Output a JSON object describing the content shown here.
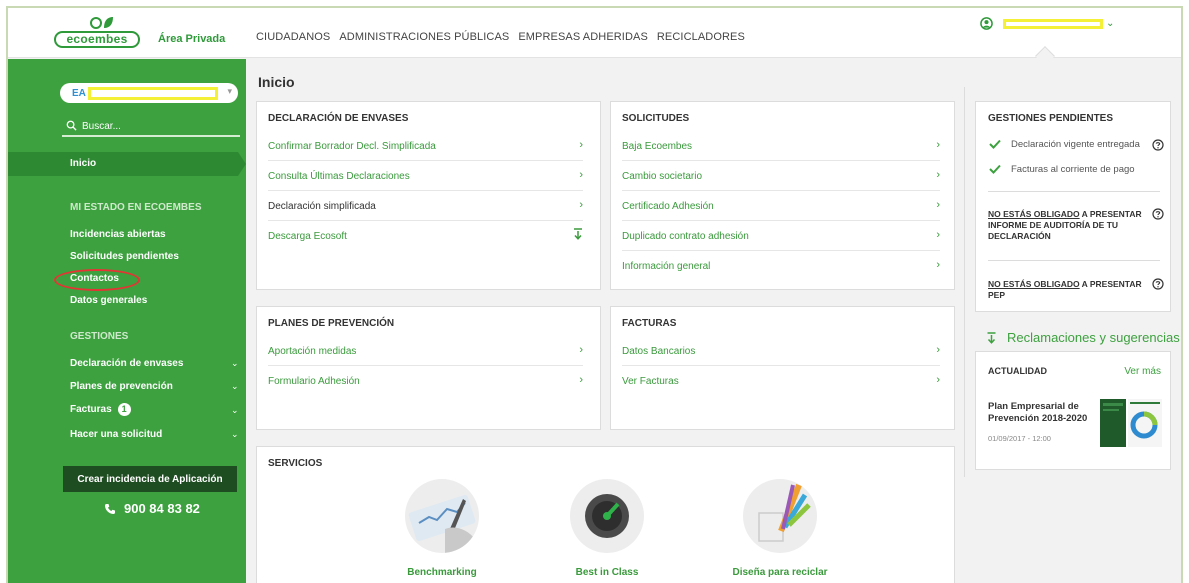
{
  "header": {
    "logo_text": "ecoembes",
    "area_label": "Área Privada",
    "nav": [
      "CIUDADANOS",
      "ADMINISTRACIONES PÚBLICAS",
      "EMPRESAS ADHERIDAS",
      "RECICLADORES"
    ],
    "user_caret": "⌄"
  },
  "sidebar": {
    "account_prefix": "EA",
    "search_placeholder": "Buscar...",
    "inicio": "Inicio",
    "estado_title": "MI ESTADO EN ECOEMBES",
    "estado_items": [
      "Incidencias abiertas",
      "Solicitudes pendientes",
      "Contactos",
      "Datos generales"
    ],
    "gestiones_title": "GESTIONES",
    "gestiones_items": [
      {
        "label": "Declaración de envases"
      },
      {
        "label": "Planes de prevención"
      },
      {
        "label": "Facturas",
        "badge": "1"
      },
      {
        "label": "Hacer una solicitud"
      }
    ],
    "crear_button": "Crear incidencia de Aplicación",
    "phone": "900 84 83 82"
  },
  "main": {
    "title": "Inicio",
    "declaracion": {
      "title": "DECLARACIÓN DE ENVASES",
      "rows": [
        "Confirmar Borrador Decl. Simplificada",
        "Consulta Últimas Declaraciones",
        "Declaración simplificada",
        "Descarga Ecosoft"
      ]
    },
    "solicitudes": {
      "title": "SOLICITUDES",
      "rows": [
        "Baja Ecoembes",
        "Cambio societario",
        "Certificado Adhesión",
        "Duplicado contrato adhesión",
        "Información general"
      ]
    },
    "planes": {
      "title": "PLANES DE PREVENCIÓN",
      "rows": [
        "Aportación medidas",
        "Formulario Adhesión"
      ]
    },
    "facturas": {
      "title": "FACTURAS",
      "rows": [
        "Datos Bancarios",
        "Ver Facturas"
      ]
    },
    "servicios": {
      "title": "SERVICIOS",
      "items": [
        "Benchmarking",
        "Best in Class",
        "Diseña para reciclar"
      ]
    }
  },
  "right": {
    "pendientes_title": "GESTIONES PENDIENTES",
    "pendientes": [
      "Declaración vigente entregada",
      "Facturas al corriente de pago"
    ],
    "legal1_u": "NO ESTÁS OBLIGADO",
    "legal1_rest": " A PRESENTAR INFORME DE AUDITORÍA DE TU DECLARACIÓN",
    "legal2_u": "NO ESTÁS OBLIGADO",
    "legal2_rest": " A PRESENTAR PEP",
    "reclamaciones": "Reclamaciones y sugerencias",
    "actualidad_title": "ACTUALIDAD",
    "ver_mas": "Ver más",
    "news_title": "Plan Empresarial de Prevención 2018-2020",
    "news_date": "01/09/2017 - 12:00"
  },
  "colors": {
    "brand_green": "#3da13f",
    "dark_green": "#1f4d22",
    "highlight_yellow": "#f4ef37",
    "circle_red": "#e53434"
  },
  "icons": [
    "user-icon",
    "search-icon",
    "chevron-right-icon",
    "download-icon",
    "check-icon",
    "question-icon",
    "phone-icon"
  ]
}
